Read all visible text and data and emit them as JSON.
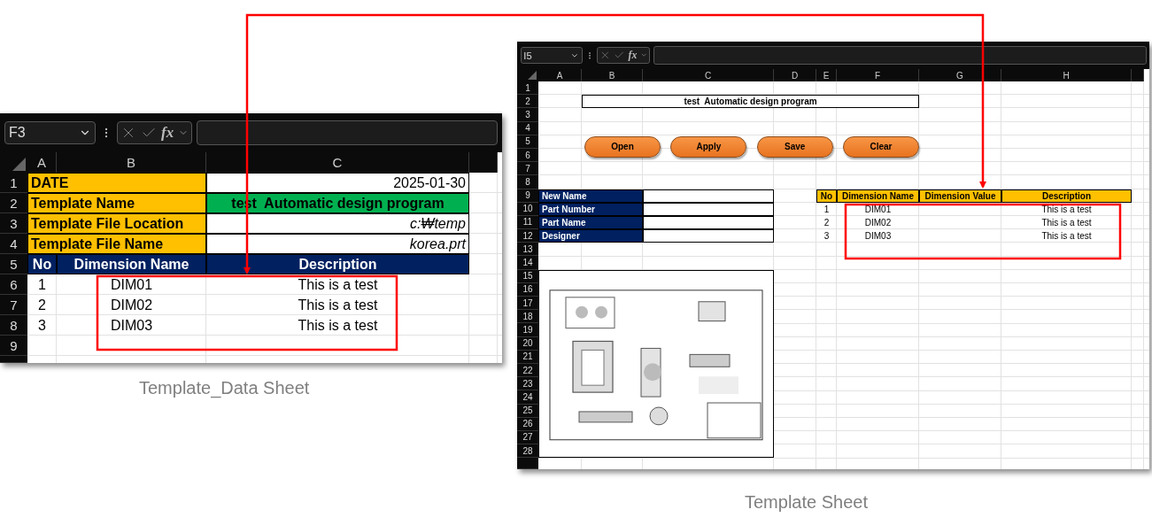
{
  "template_data_sheet": {
    "name_box": "F3",
    "function_label": "fx",
    "columns": [
      "A",
      "B",
      "C"
    ],
    "rows": [
      "1",
      "2",
      "3",
      "4",
      "5",
      "6",
      "7",
      "8",
      "9"
    ],
    "info_rows": [
      {
        "label": "DATE",
        "value": "2025-01-30",
        "kind": "date"
      },
      {
        "label": "Template Name",
        "value": "test  Automatic design program",
        "kind": "highlight"
      },
      {
        "label": "Template File Location",
        "value": "c:₩temp",
        "kind": "path"
      },
      {
        "label": "Template File Name",
        "value": "korea.prt",
        "kind": "path"
      }
    ],
    "table": {
      "columns": [
        "No",
        "Dimension Name",
        "Description"
      ],
      "rows": [
        {
          "no": "1",
          "name": "DIM01",
          "description": "This is a test"
        },
        {
          "no": "2",
          "name": "DIM02",
          "description": "This is a test"
        },
        {
          "no": "3",
          "name": "DIM03",
          "description": "This is a test"
        }
      ]
    },
    "caption": "Template_Data Sheet"
  },
  "template_sheet": {
    "name_box": "I5",
    "function_label": "fx",
    "columns": [
      "A",
      "B",
      "C",
      "D",
      "E",
      "F",
      "G",
      "H"
    ],
    "rows": [
      "1",
      "2",
      "3",
      "4",
      "5",
      "6",
      "7",
      "8",
      "9",
      "10",
      "11",
      "12",
      "13",
      "14",
      "15",
      "16",
      "17",
      "18",
      "19",
      "20",
      "21",
      "22",
      "23",
      "24",
      "25",
      "26",
      "27",
      "28"
    ],
    "title": "test  Automatic design program",
    "buttons": [
      "Open",
      "Apply",
      "Save",
      "Clear"
    ],
    "fields": [
      "New Name",
      "Part Number",
      "Part Name",
      "Designer"
    ],
    "table": {
      "columns": [
        "No",
        "Dimension Name",
        "Dimension Value",
        "Description"
      ],
      "rows": [
        {
          "no": "1",
          "name": "DIM01",
          "description": "This is a test"
        },
        {
          "no": "2",
          "name": "DIM02",
          "description": "This is a test"
        },
        {
          "no": "3",
          "name": "DIM03",
          "description": "This is a test"
        }
      ]
    },
    "drawing": {
      "kind": "picture"
    },
    "caption": "Template Sheet"
  }
}
